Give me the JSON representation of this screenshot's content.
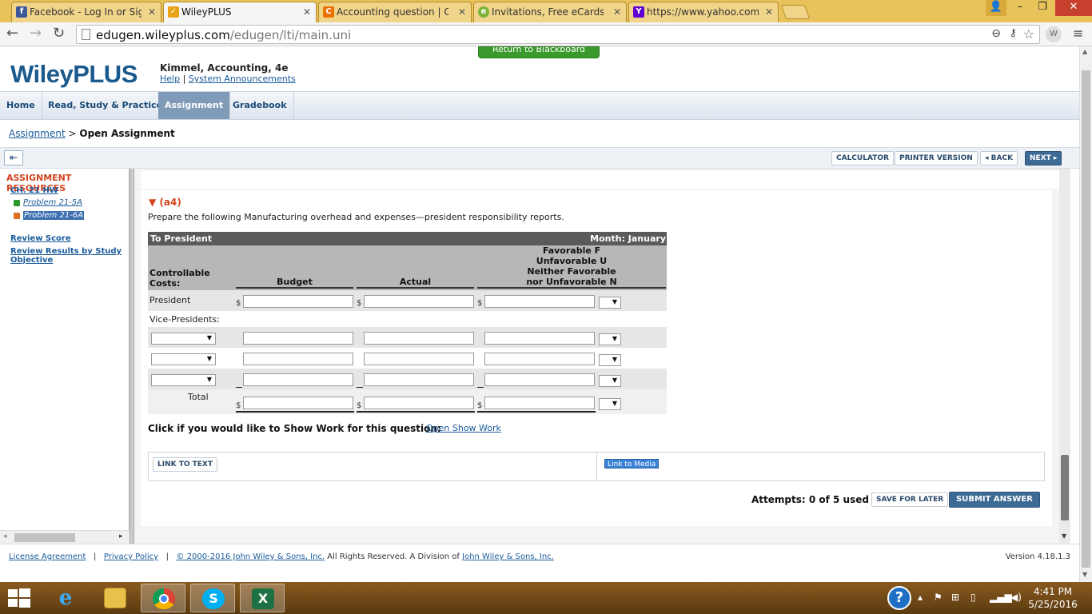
{
  "browser": {
    "tabs": [
      {
        "label": "Facebook - Log In or Sign",
        "icon": "facebook-icon",
        "color": "#3b5998",
        "glyph": "f"
      },
      {
        "label": "WileyPLUS",
        "icon": "check-icon",
        "color": "#e8a317",
        "glyph": "✓"
      },
      {
        "label": "Accounting question | Che",
        "icon": "chegg-icon",
        "color": "#eb7100",
        "glyph": "C"
      },
      {
        "label": "Invitations, Free eCards an",
        "icon": "evite-icon",
        "color": "#7bb33a",
        "glyph": "e"
      },
      {
        "label": "https://www.yahoo.com/",
        "icon": "yahoo-icon",
        "color": "#5f01d1",
        "glyph": "Y"
      }
    ],
    "url_domain": "edugen.wileyplus.com",
    "url_path": "/edugen/lti/main.uni",
    "profile_initial": "W"
  },
  "header": {
    "logo": "WileyPLUS",
    "book_title": "Kimmel, Accounting, 4e",
    "help": "Help",
    "announcements": "System Announcements",
    "return_button": "Return to Blackboard"
  },
  "nav": [
    "Home",
    "Read, Study & Practice",
    "Assignment",
    "Gradebook"
  ],
  "breadcrumb": {
    "link": "Assignment",
    "sep": ">",
    "current": "Open Assignment"
  },
  "actions": {
    "calculator": "CALCULATOR",
    "printer": "PRINTER VERSION",
    "back": "◂ BACK",
    "next": "NEXT ▸"
  },
  "sidebar": {
    "heading": "ASSIGNMENT RESOURCES",
    "chapter": "CH. 21 HW",
    "problems": [
      {
        "label": "Problem 21-5A",
        "status_color": "#2c9a2c"
      },
      {
        "label": "Problem 21-6A",
        "status_color": "#e07020"
      }
    ],
    "review_score": "Review Score",
    "review_results": "Review Results by Study Objective"
  },
  "question": {
    "part": "(a4)",
    "prompt": "Prepare the following Manufacturing overhead and expenses—president responsibility reports.",
    "table": {
      "to": "To President",
      "month": "Month: January",
      "col_costs": "Controllable Costs:",
      "col_budget": "Budget",
      "col_actual": "Actual",
      "col_fav": [
        "Favorable F",
        "Unfavorable U",
        "Neither Favorable",
        "nor Unfavorable N"
      ],
      "row_president": "President",
      "row_vp": "Vice-Presidents:",
      "row_total": "Total",
      "currency": "$"
    },
    "show_work_label": "Click if you would like to Show Work for this question:",
    "open_show_work": "Open Show Work",
    "link_to_text": "LINK TO TEXT",
    "link_to_media": "Link to Media",
    "attempts": "Attempts: 0 of 5 used",
    "save_later": "SAVE FOR LATER",
    "submit": "SUBMIT ANSWER"
  },
  "footer": {
    "license": "License Agreement",
    "privacy": "Privacy Policy",
    "copyright": "© 2000-2016 John Wiley & Sons, Inc.",
    "rights": "All Rights Reserved. A Division of",
    "company": "John Wiley & Sons, Inc.",
    "version": "Version 4.18.1.3"
  },
  "taskbar": {
    "time": "4:41 PM",
    "date": "5/25/2016"
  }
}
